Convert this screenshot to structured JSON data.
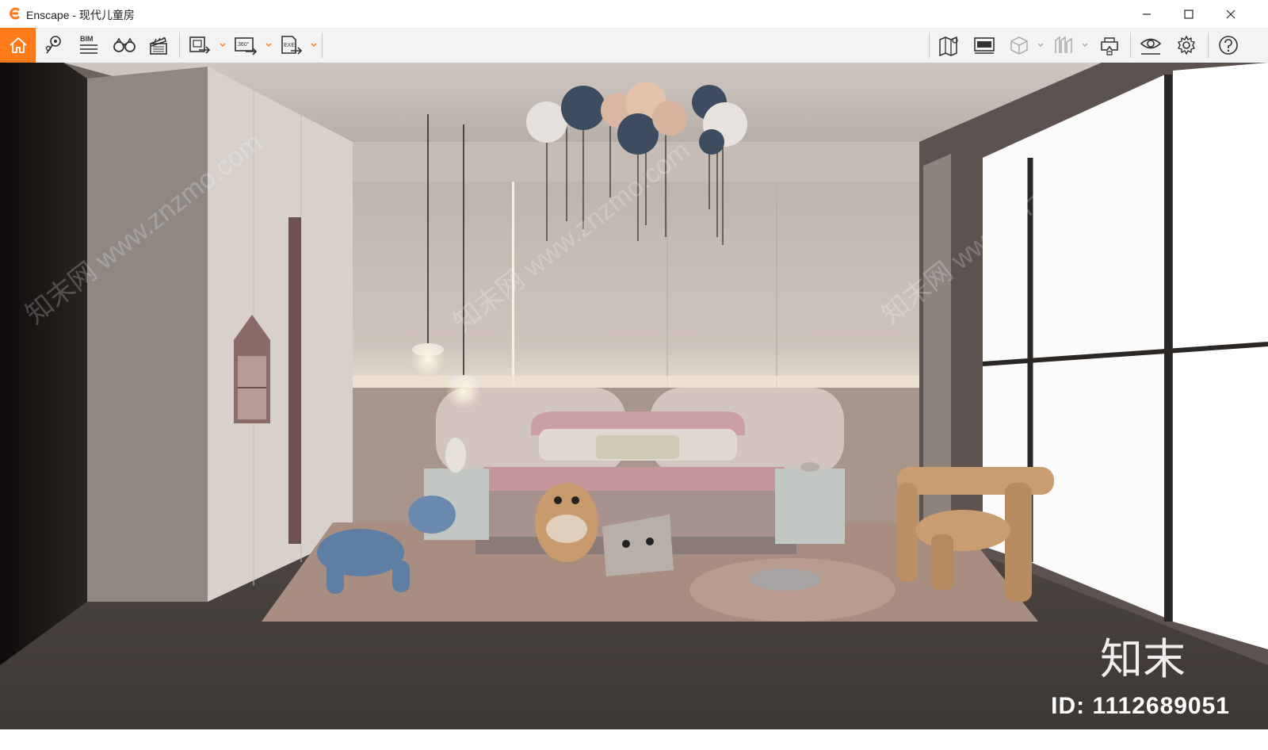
{
  "window": {
    "app_name": "Enscape",
    "title": "Enscape - 现代儿童房",
    "minimize_icon": "minimize-icon",
    "maximize_icon": "maximize-icon",
    "close_icon": "close-icon"
  },
  "toolbar": {
    "accent_color": "#ff7a1a",
    "left_tools": [
      {
        "name": "home",
        "icon": "home-icon"
      },
      {
        "name": "views",
        "icon": "map-pin-icon"
      },
      {
        "name": "bim",
        "icon": "bim-icon",
        "label": "BIM"
      },
      {
        "name": "binoculars",
        "icon": "binoculars-icon"
      },
      {
        "name": "video",
        "icon": "clapperboard-icon"
      }
    ],
    "export_tools": [
      {
        "name": "screenshot",
        "icon": "export-image-icon"
      },
      {
        "name": "panorama",
        "icon": "export-panorama-icon",
        "label": "360°"
      },
      {
        "name": "standalone",
        "icon": "export-exe-icon",
        "label": "EXE"
      }
    ],
    "right_tools": [
      {
        "name": "map",
        "icon": "map-icon"
      },
      {
        "name": "live-update",
        "icon": "monitor-icon"
      },
      {
        "name": "cube",
        "icon": "cube-icon"
      },
      {
        "name": "asset-library",
        "icon": "library-icon"
      },
      {
        "name": "vr",
        "icon": "vr-headset-icon"
      },
      {
        "name": "visibility",
        "icon": "eye-icon"
      },
      {
        "name": "settings",
        "icon": "gear-icon"
      },
      {
        "name": "help",
        "icon": "help-icon"
      }
    ]
  },
  "viewport": {
    "watermark_logo": "知末",
    "watermark_id": "ID: 1112689051",
    "watermark_text": "知末网 www.znzmo.com"
  }
}
